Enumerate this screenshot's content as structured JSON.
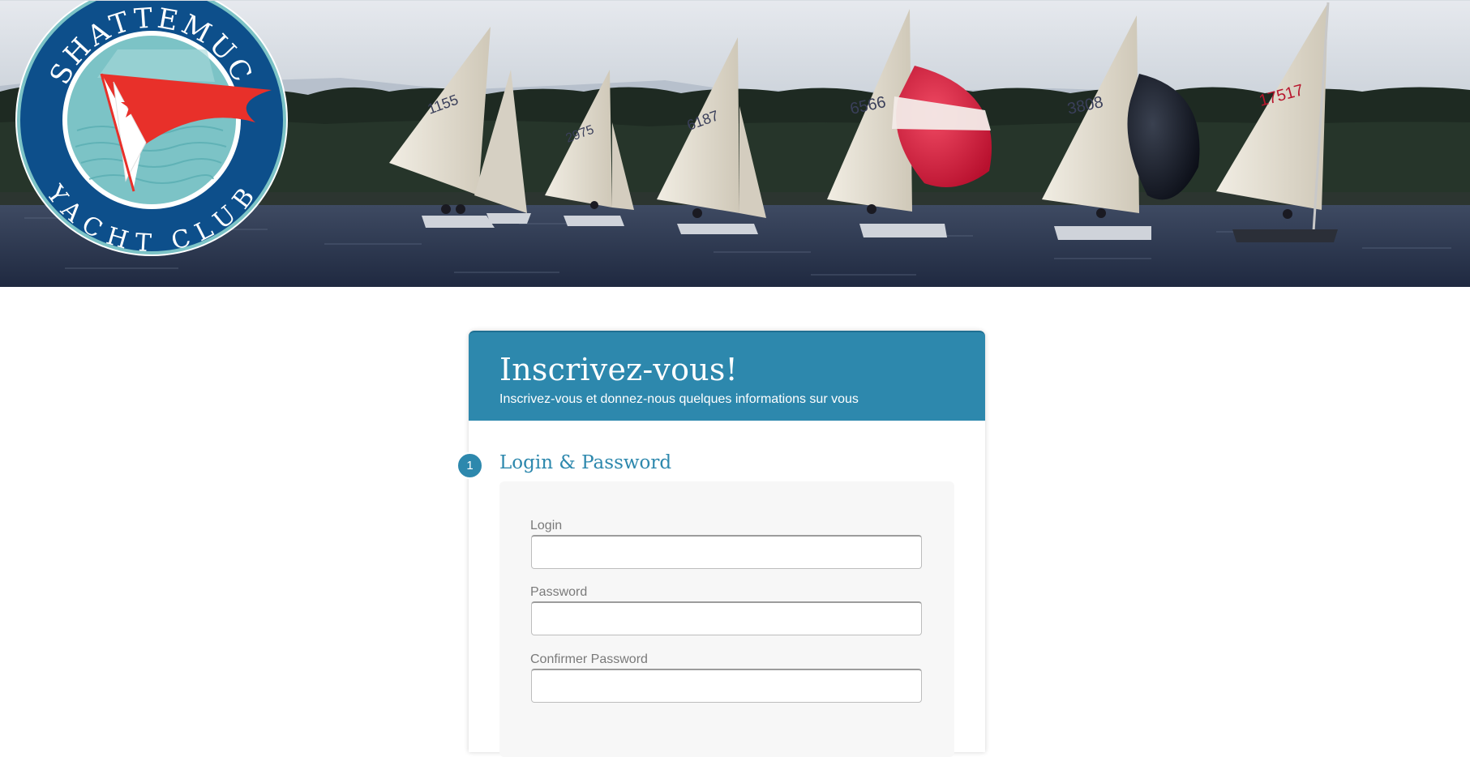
{
  "banner": {
    "logo": {
      "top_text": "SHATTEMUC",
      "bottom_text": "YACHT CLUB"
    },
    "sail_numbers": [
      "1155",
      "2975",
      "6187",
      "6566",
      "3808",
      "17517"
    ]
  },
  "form": {
    "title": "Inscrivez-vous!",
    "subtitle": "Inscrivez-vous et donnez-nous quelques informations sur vous",
    "step_number": "1",
    "section_title": "Login & Password",
    "fields": [
      {
        "label": "Login",
        "value": ""
      },
      {
        "label": "Password",
        "value": ""
      },
      {
        "label": "Confirmer Password",
        "value": ""
      }
    ]
  },
  "colors": {
    "accent": "#2d88ad",
    "logo_navy": "#0d4f8b",
    "logo_teal": "#7cc3c6",
    "flag_red": "#e8302a"
  }
}
